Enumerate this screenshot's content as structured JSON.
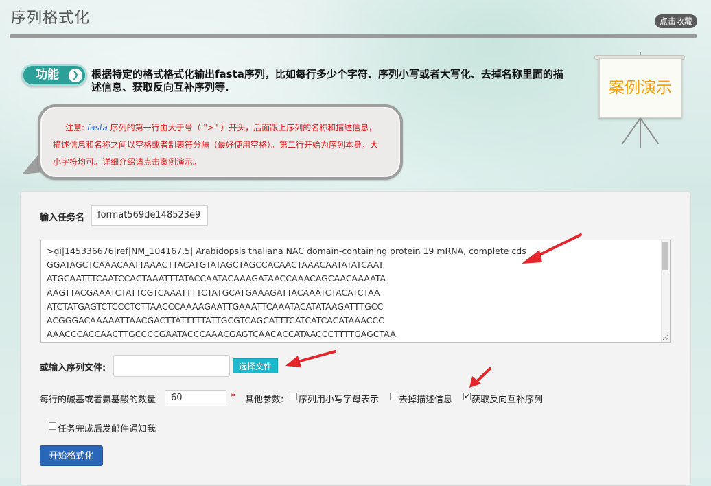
{
  "header": {
    "title": "序列格式化",
    "favorite_label": "点击收藏"
  },
  "intro": {
    "badge_label": "功能",
    "badge_chevron": "❯",
    "description": "根据特定的格式格式化输出fasta序列，比如每行多少个字符、序列小写或者大写化、去掉名称里面的描述信息、获取反向互补序列等."
  },
  "notice": {
    "prefix": "注意: ",
    "fasta_word": "fasta",
    "body": " 序列的第一行由大于号（  \">\"  ）开头，后面跟上序列的名称和描述信息，描述信息和名称之间以空格或者制表符分隔（最好使用空格）。第二行开始为序列本身，大小字符均可。详细介绍请点击案例演示。"
  },
  "demo": {
    "label": "案例演示"
  },
  "form": {
    "task_name_label": "输入任务名",
    "task_name_value": "format569de148523e9",
    "sequence_lines": [
      ">gi|145336676|ref|NM_104167.5| Arabidopsis thaliana NAC domain-containing protein 19 mRNA, complete cds",
      "GGATAGCTCAAACAATTAAACTTACATGTATAGCTAGCCACAACTAAACAATATATCAAT",
      "ATGCAATTTCAATCCACTAAATTTATACCAATACAAAGATAACCAAACAGCAACAAAATA",
      "AAGTTACGAAATCTATTCGTCAAATTTTCTATGCATGAAAGATTACAAATCTACATCTAA",
      "ATCTATGAGTCTCCCTCTTAACCCAAAAGAATTGAAATTCAAATACATATAAGATTTGCC",
      "ACGGGACAAAAATTAACGACTTATTTTTATTGCGTCAGCATTTCATCATCACATAAACCC",
      "AAACCCACCAACTTGCCCCGAATACCCAAACGAGTCAACACCATAACCCTTTTGAGCTAA"
    ],
    "file_label": "或输入序列文件:",
    "file_value": "",
    "file_button": "选择文件",
    "line_length_label": "每行的碱基或者氨基酸的数量",
    "line_length_value": "60",
    "required_mark": "*",
    "other_params_label": "其他参数:",
    "options": [
      {
        "label": "序列用小写字母表示",
        "checked": false
      },
      {
        "label": "去掉描述信息",
        "checked": false
      },
      {
        "label": "获取反向互补序列",
        "checked": true
      }
    ],
    "email_notify_label": "任务完成后发邮件通知我",
    "email_notify_checked": false,
    "submit_label": "开始格式化"
  },
  "colors": {
    "accent_teal": "#2d9f99",
    "notice_red": "#e01818",
    "demo_orange": "#f2a111",
    "file_button": "#1bb9cc",
    "submit_button": "#2a67b8",
    "arrow_red": "#e3262b"
  }
}
